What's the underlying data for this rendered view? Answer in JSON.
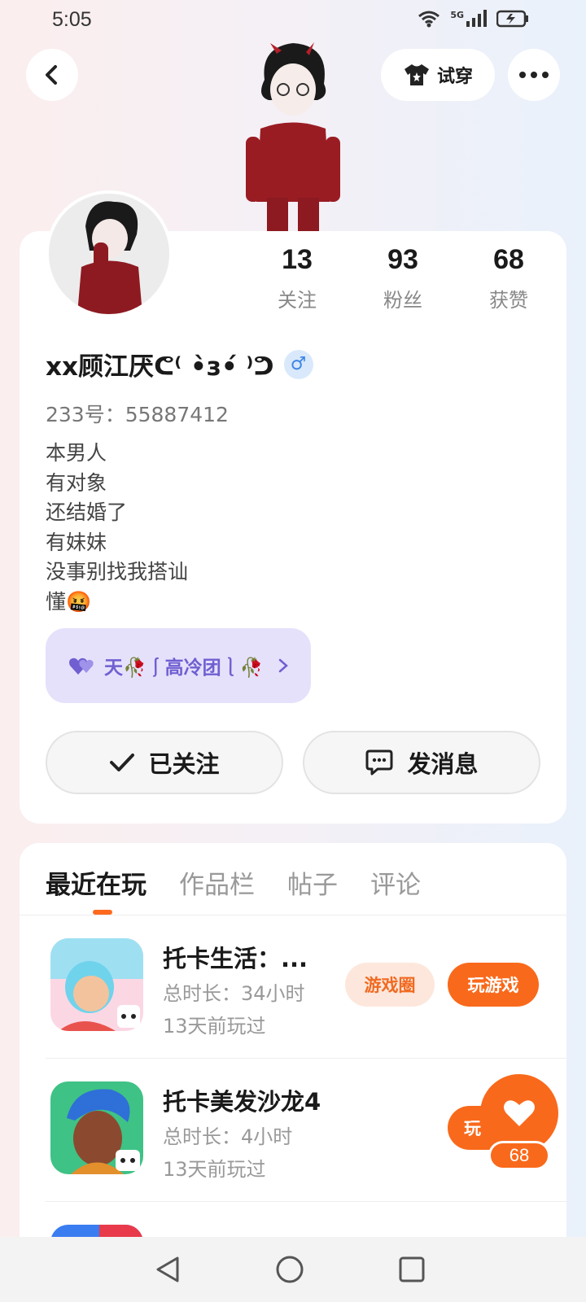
{
  "status_bar": {
    "time": "5:05",
    "network_label": "5G"
  },
  "header": {
    "tryon_label": "试穿"
  },
  "profile": {
    "stats": [
      {
        "value": "13",
        "label": "关注"
      },
      {
        "value": "93",
        "label": "粉丝"
      },
      {
        "value": "68",
        "label": "获赞"
      }
    ],
    "nickname": "xx顾江厌ᕦ⁽ •̀з•́ ⁾ᕤ",
    "gender_symbol": "♂",
    "user_id": "233号：55887412",
    "bio": [
      "本男人",
      "有对象",
      "还结婚了",
      "有妹妹",
      "没事别找我搭讪",
      "懂🤬"
    ],
    "group_name": "天🥀⎰高冷团⎱🥀",
    "follow_label": "已关注",
    "message_label": "发消息"
  },
  "tabs": [
    {
      "label": "最近在玩",
      "active": true
    },
    {
      "label": "作品栏",
      "active": false
    },
    {
      "label": "帖子",
      "active": false
    },
    {
      "label": "评论",
      "active": false
    }
  ],
  "games": [
    {
      "name": "托卡生活：...",
      "duration": "总时长：34小时",
      "last_played": "13天前玩过",
      "circle_label": "游戏圈",
      "play_label": "玩游戏"
    },
    {
      "name": "托卡美发沙龙4",
      "duration": "总时长：4小时",
      "last_played": "13天前玩过",
      "circle_label": "",
      "play_label": "玩"
    }
  ],
  "like_fab": {
    "count": "68"
  },
  "colors": {
    "accent": "#f9691b",
    "accent_light": "#fde7dc",
    "group_bg": "#e5e1fb",
    "group_text": "#6f5fd1",
    "gender": "#3d86e6"
  }
}
